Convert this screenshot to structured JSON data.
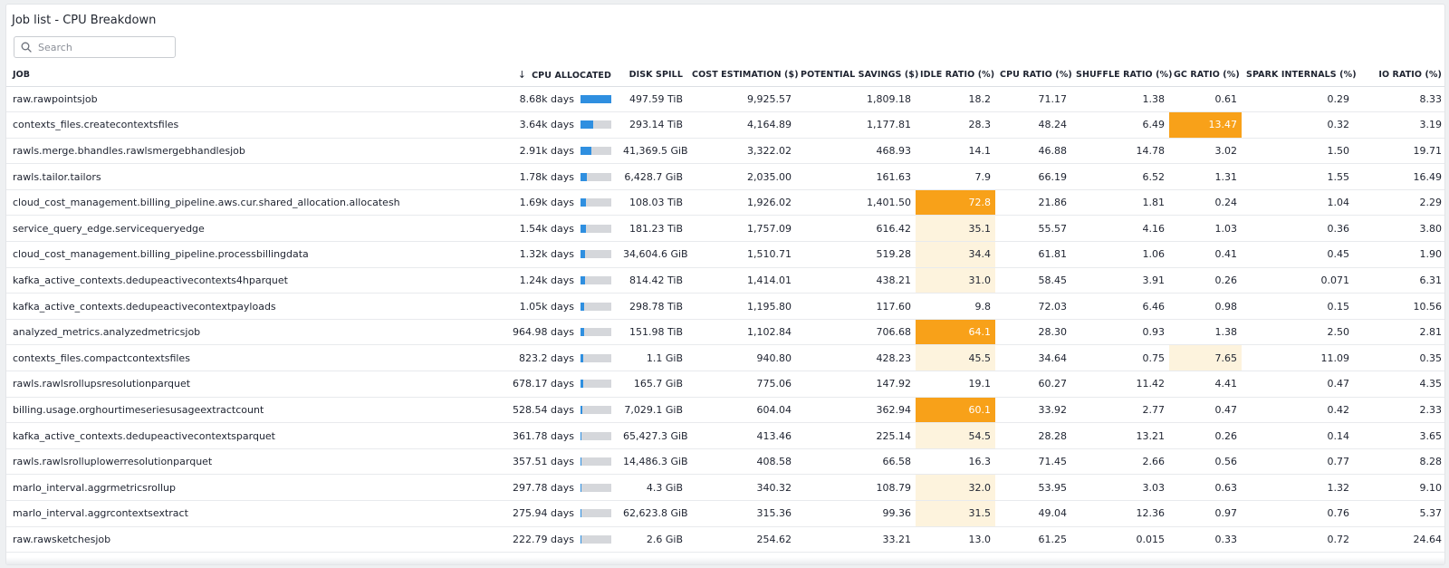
{
  "panel": {
    "title": "Job list - CPU Breakdown"
  },
  "search": {
    "placeholder": "Search",
    "icon": "search-icon"
  },
  "columns": [
    "JOB",
    "CPU ALLOCATED",
    "DISK SPILL",
    "COST ESTIMATION ($)",
    "POTENTIAL SAVINGS ($)",
    "IDLE RATIO (%)",
    "CPU RATIO (%)",
    "SHUFFLE RATIO (%)",
    "GC RATIO (%)",
    "SPARK INTERNALS (%)",
    "IO RATIO (%)"
  ],
  "sort": {
    "column": "CPU ALLOCATED",
    "direction": "descending",
    "icon": "arrow-down-icon"
  },
  "colors": {
    "bar_fill": "#2f8fe0",
    "bar_track": "#d5d7db",
    "highlight_strong": "#f8a119",
    "highlight_light": "#fdf3dd"
  },
  "rows": [
    {
      "job": "raw.rawpointsjob",
      "cpu": "8.68k days",
      "cpu_fraction": 1.0,
      "disk_spill": "497.59 TiB",
      "cost": "9,925.57",
      "savings": "1,809.18",
      "idle": "18.2",
      "cpu_ratio": "71.17",
      "shuffle": "1.38",
      "gc": "0.61",
      "spark": "0.29",
      "io": "8.33"
    },
    {
      "job": "contexts_files.createcontextsfiles",
      "cpu": "3.64k days",
      "cpu_fraction": 0.42,
      "disk_spill": "293.14 TiB",
      "cost": "4,164.89",
      "savings": "1,177.81",
      "idle": "28.3",
      "cpu_ratio": "48.24",
      "shuffle": "6.49",
      "gc": "13.47",
      "spark": "0.32",
      "io": "3.19"
    },
    {
      "job": "rawls.merge.bhandles.rawlsmergebhandlesjob",
      "cpu": "2.91k days",
      "cpu_fraction": 0.34,
      "disk_spill": "41,369.5 GiB",
      "cost": "3,322.02",
      "savings": "468.93",
      "idle": "14.1",
      "cpu_ratio": "46.88",
      "shuffle": "14.78",
      "gc": "3.02",
      "spark": "1.50",
      "io": "19.71"
    },
    {
      "job": "rawls.tailor.tailors",
      "cpu": "1.78k days",
      "cpu_fraction": 0.2,
      "disk_spill": "6,428.7 GiB",
      "cost": "2,035.00",
      "savings": "161.63",
      "idle": "7.9",
      "cpu_ratio": "66.19",
      "shuffle": "6.52",
      "gc": "1.31",
      "spark": "1.55",
      "io": "16.49"
    },
    {
      "job": "cloud_cost_management.billing_pipeline.aws.cur.shared_allocation.allocateshar",
      "cpu": "1.69k days",
      "cpu_fraction": 0.19,
      "disk_spill": "108.03 TiB",
      "cost": "1,926.02",
      "savings": "1,401.50",
      "idle": "72.8",
      "cpu_ratio": "21.86",
      "shuffle": "1.81",
      "gc": "0.24",
      "spark": "1.04",
      "io": "2.29"
    },
    {
      "job": "service_query_edge.servicequeryedge",
      "cpu": "1.54k days",
      "cpu_fraction": 0.18,
      "disk_spill": "181.23 TiB",
      "cost": "1,757.09",
      "savings": "616.42",
      "idle": "35.1",
      "cpu_ratio": "55.57",
      "shuffle": "4.16",
      "gc": "1.03",
      "spark": "0.36",
      "io": "3.80"
    },
    {
      "job": "cloud_cost_management.billing_pipeline.processbillingdata",
      "cpu": "1.32k days",
      "cpu_fraction": 0.15,
      "disk_spill": "34,604.6 GiB",
      "cost": "1,510.71",
      "savings": "519.28",
      "idle": "34.4",
      "cpu_ratio": "61.81",
      "shuffle": "1.06",
      "gc": "0.41",
      "spark": "0.45",
      "io": "1.90"
    },
    {
      "job": "kafka_active_contexts.dedupeactivecontexts4hparquet",
      "cpu": "1.24k days",
      "cpu_fraction": 0.14,
      "disk_spill": "814.42 TiB",
      "cost": "1,414.01",
      "savings": "438.21",
      "idle": "31.0",
      "cpu_ratio": "58.45",
      "shuffle": "3.91",
      "gc": "0.26",
      "spark": "0.071",
      "io": "6.31"
    },
    {
      "job": "kafka_active_contexts.dedupeactivecontextpayloads",
      "cpu": "1.05k days",
      "cpu_fraction": 0.12,
      "disk_spill": "298.78 TiB",
      "cost": "1,195.80",
      "savings": "117.60",
      "idle": "9.8",
      "cpu_ratio": "72.03",
      "shuffle": "6.46",
      "gc": "0.98",
      "spark": "0.15",
      "io": "10.56"
    },
    {
      "job": "analyzed_metrics.analyzedmetricsjob",
      "cpu": "964.98 days",
      "cpu_fraction": 0.11,
      "disk_spill": "151.98 TiB",
      "cost": "1,102.84",
      "savings": "706.68",
      "idle": "64.1",
      "cpu_ratio": "28.30",
      "shuffle": "0.93",
      "gc": "1.38",
      "spark": "2.50",
      "io": "2.81"
    },
    {
      "job": "contexts_files.compactcontextsfiles",
      "cpu": "823.2 days",
      "cpu_fraction": 0.095,
      "disk_spill": "1.1 GiB",
      "cost": "940.80",
      "savings": "428.23",
      "idle": "45.5",
      "cpu_ratio": "34.64",
      "shuffle": "0.75",
      "gc": "7.65",
      "spark": "11.09",
      "io": "0.35"
    },
    {
      "job": "rawls.rawlsrollupsresolutionparquet",
      "cpu": "678.17 days",
      "cpu_fraction": 0.08,
      "disk_spill": "165.7 GiB",
      "cost": "775.06",
      "savings": "147.92",
      "idle": "19.1",
      "cpu_ratio": "60.27",
      "shuffle": "11.42",
      "gc": "4.41",
      "spark": "0.47",
      "io": "4.35"
    },
    {
      "job": "billing.usage.orghourtimeseriesusageextractcount",
      "cpu": "528.54 days",
      "cpu_fraction": 0.06,
      "disk_spill": "7,029.1 GiB",
      "cost": "604.04",
      "savings": "362.94",
      "idle": "60.1",
      "cpu_ratio": "33.92",
      "shuffle": "2.77",
      "gc": "0.47",
      "spark": "0.42",
      "io": "2.33"
    },
    {
      "job": "kafka_active_contexts.dedupeactivecontextsparquet",
      "cpu": "361.78 days",
      "cpu_fraction": 0.042,
      "disk_spill": "65,427.3 GiB",
      "cost": "413.46",
      "savings": "225.14",
      "idle": "54.5",
      "cpu_ratio": "28.28",
      "shuffle": "13.21",
      "gc": "0.26",
      "spark": "0.14",
      "io": "3.65"
    },
    {
      "job": "rawls.rawlsrolluplowerresolutionparquet",
      "cpu": "357.51 days",
      "cpu_fraction": 0.041,
      "disk_spill": "14,486.3 GiB",
      "cost": "408.58",
      "savings": "66.58",
      "idle": "16.3",
      "cpu_ratio": "71.45",
      "shuffle": "2.66",
      "gc": "0.56",
      "spark": "0.77",
      "io": "8.28"
    },
    {
      "job": "marlo_interval.aggrmetricsrollup",
      "cpu": "297.78 days",
      "cpu_fraction": 0.034,
      "disk_spill": "4.3 GiB",
      "cost": "340.32",
      "savings": "108.79",
      "idle": "32.0",
      "cpu_ratio": "53.95",
      "shuffle": "3.03",
      "gc": "0.63",
      "spark": "1.32",
      "io": "9.10"
    },
    {
      "job": "marlo_interval.aggrcontextsextract",
      "cpu": "275.94 days",
      "cpu_fraction": 0.032,
      "disk_spill": "62,623.8 GiB",
      "cost": "315.36",
      "savings": "99.36",
      "idle": "31.5",
      "cpu_ratio": "49.04",
      "shuffle": "12.36",
      "gc": "0.97",
      "spark": "0.76",
      "io": "5.37"
    },
    {
      "job": "raw.rawsketchesjob",
      "cpu": "222.79 days",
      "cpu_fraction": 0.026,
      "disk_spill": "2.6 GiB",
      "cost": "254.62",
      "savings": "33.21",
      "idle": "13.0",
      "cpu_ratio": "61.25",
      "shuffle": "0.015",
      "gc": "0.33",
      "spark": "0.72",
      "io": "24.64"
    }
  ]
}
